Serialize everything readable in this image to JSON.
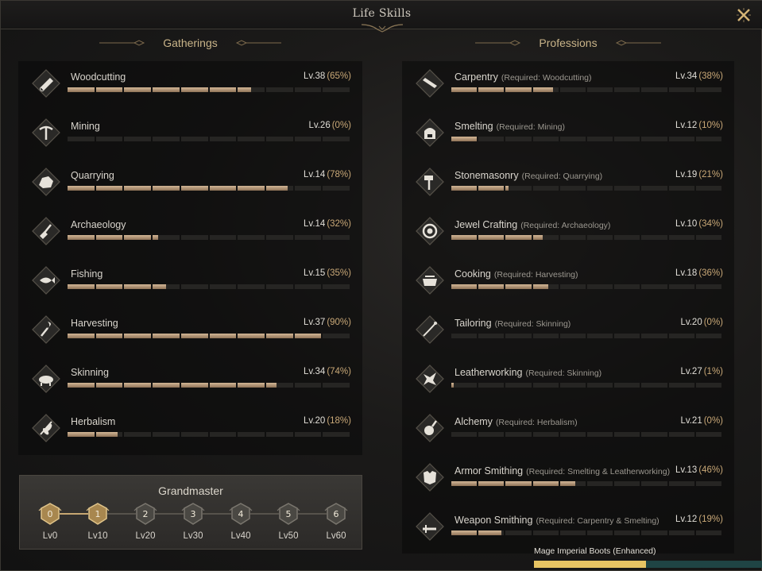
{
  "window": {
    "title": "Life Skills"
  },
  "gatherings": {
    "header": "Gatherings",
    "items": [
      {
        "name": "Woodcutting",
        "level": "Lv.38",
        "percent": "(65%)",
        "progress": 0.65,
        "icon": "log-icon"
      },
      {
        "name": "Mining",
        "level": "Lv.26",
        "percent": "(0%)",
        "progress": 0.0,
        "icon": "pickaxe-icon"
      },
      {
        "name": "Quarrying",
        "level": "Lv.14",
        "percent": "(78%)",
        "progress": 0.78,
        "icon": "ore-icon"
      },
      {
        "name": "Archaeology",
        "level": "Lv.14",
        "percent": "(32%)",
        "progress": 0.32,
        "icon": "shovel-icon"
      },
      {
        "name": "Fishing",
        "level": "Lv.15",
        "percent": "(35%)",
        "progress": 0.35,
        "icon": "fish-icon"
      },
      {
        "name": "Harvesting",
        "level": "Lv.37",
        "percent": "(90%)",
        "progress": 0.9,
        "icon": "sickle-icon"
      },
      {
        "name": "Skinning",
        "level": "Lv.34",
        "percent": "(74%)",
        "progress": 0.74,
        "icon": "boar-icon"
      },
      {
        "name": "Herbalism",
        "level": "Lv.20",
        "percent": "(18%)",
        "progress": 0.18,
        "icon": "leaf-icon"
      }
    ]
  },
  "professions": {
    "header": "Professions",
    "items": [
      {
        "name": "Carpentry",
        "req": "(Required: Woodcutting)",
        "level": "Lv.34",
        "percent": "(38%)",
        "progress": 0.38,
        "icon": "saw-icon"
      },
      {
        "name": "Smelting",
        "req": "(Required: Mining)",
        "level": "Lv.12",
        "percent": "(10%)",
        "progress": 0.1,
        "icon": "furnace-icon"
      },
      {
        "name": "Stonemasonry",
        "req": "(Required: Quarrying)",
        "level": "Lv.19",
        "percent": "(21%)",
        "progress": 0.21,
        "icon": "hammer-icon"
      },
      {
        "name": "Jewel Crafting",
        "req": "(Required: Archaeology)",
        "level": "Lv.10",
        "percent": "(34%)",
        "progress": 0.34,
        "icon": "gem-ring-icon"
      },
      {
        "name": "Cooking",
        "req": "(Required: Harvesting)",
        "level": "Lv.18",
        "percent": "(36%)",
        "progress": 0.36,
        "icon": "pot-icon"
      },
      {
        "name": "Tailoring",
        "req": "(Required: Skinning)",
        "level": "Lv.20",
        "percent": "(0%)",
        "progress": 0.0,
        "icon": "needle-icon"
      },
      {
        "name": "Leatherworking",
        "req": "(Required: Skinning)",
        "level": "Lv.27",
        "percent": "(1%)",
        "progress": 0.01,
        "icon": "hide-icon"
      },
      {
        "name": "Alchemy",
        "req": "(Required: Herbalism)",
        "level": "Lv.21",
        "percent": "(0%)",
        "progress": 0.0,
        "icon": "flask-icon"
      },
      {
        "name": "Armor Smithing",
        "req": "(Required: Smelting & Leatherworking)",
        "level": "Lv.13",
        "percent": "(46%)",
        "progress": 0.46,
        "icon": "armor-icon"
      },
      {
        "name": "Weapon Smithing",
        "req": "(Required: Carpentry & Smelting)",
        "level": "Lv.12",
        "percent": "(19%)",
        "progress": 0.19,
        "icon": "sword-icon"
      }
    ]
  },
  "grandmaster": {
    "title": "Grandmaster",
    "unlocked_count": 2,
    "tiers": [
      {
        "num": "0",
        "label": "Lv0"
      },
      {
        "num": "1",
        "label": "Lv10"
      },
      {
        "num": "2",
        "label": "Lv20"
      },
      {
        "num": "3",
        "label": "Lv30"
      },
      {
        "num": "4",
        "label": "Lv40"
      },
      {
        "num": "5",
        "label": "Lv50"
      },
      {
        "num": "6",
        "label": "Lv60"
      }
    ]
  },
  "notification": {
    "label": "Mage Imperial Boots (Enhanced)",
    "progress": 0.49
  },
  "colors": {
    "accent": "#c9a877",
    "bar_fill": "#c2a584",
    "notification_fill": "#e7c463",
    "notification_track": "#1f4444"
  }
}
